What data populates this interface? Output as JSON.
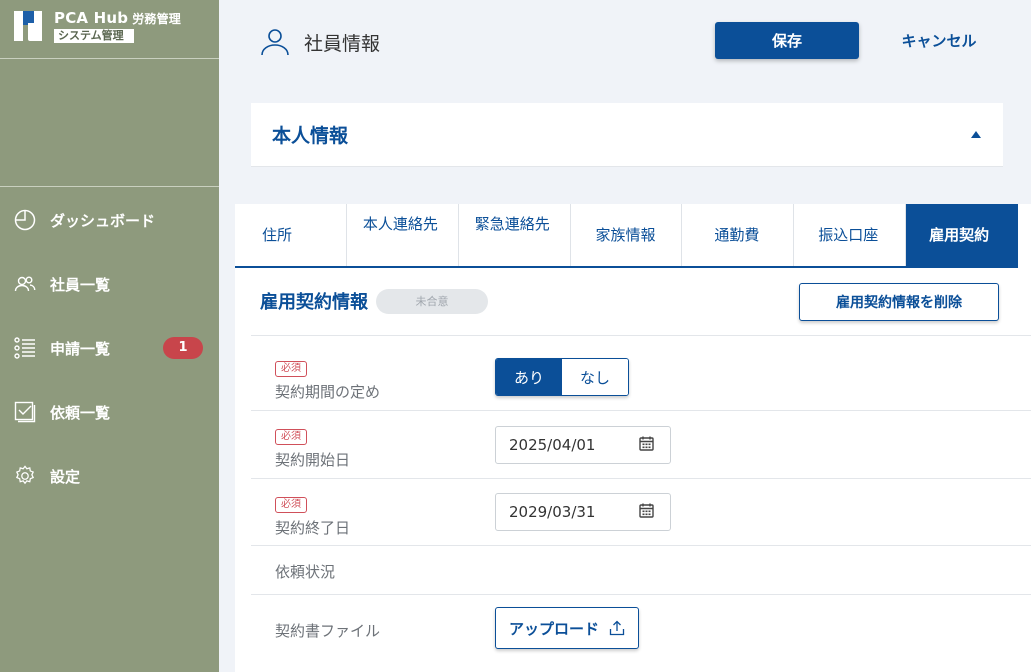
{
  "app": {
    "name": "PCA Hub",
    "module": "労務管理",
    "tag": "システム管理"
  },
  "sidebar": {
    "items": [
      {
        "label": "ダッシュボード",
        "icon": "pie-chart-icon"
      },
      {
        "label": "社員一覧",
        "icon": "users-icon"
      },
      {
        "label": "申請一覧",
        "icon": "list-icon",
        "badge": "1"
      },
      {
        "label": "依頼一覧",
        "icon": "checklist-icon"
      },
      {
        "label": "設定",
        "icon": "gear-icon"
      }
    ]
  },
  "header": {
    "title": "社員情報",
    "save_label": "保存",
    "cancel_label": "キャンセル"
  },
  "section": {
    "title": "本人情報"
  },
  "tabs": [
    {
      "label": "住所"
    },
    {
      "label": "本人連絡先"
    },
    {
      "label": "緊急連絡先"
    },
    {
      "label": "家族情報"
    },
    {
      "label": "通勤費"
    },
    {
      "label": "振込口座"
    },
    {
      "label": "雇用契約",
      "active": true
    }
  ],
  "contract": {
    "title": "雇用契約情報",
    "status": "未合意",
    "delete_label": "雇用契約情報を削除",
    "required_label": "必須",
    "fields": {
      "period": {
        "label": "契約期間の定め",
        "options": [
          "あり",
          "なし"
        ],
        "selected": "あり"
      },
      "start": {
        "label": "契約開始日",
        "value": "2025/04/01"
      },
      "end": {
        "label": "契約終了日",
        "value": "2029/03/31"
      },
      "request_status": {
        "label": "依頼状況"
      },
      "file": {
        "label": "契約書ファイル",
        "upload_label": "アップロード"
      }
    }
  },
  "colors": {
    "sidebar_bg": "#8e9a7d",
    "primary": "#0b4f98",
    "badge": "#c8454b",
    "required": "#d0505a"
  }
}
